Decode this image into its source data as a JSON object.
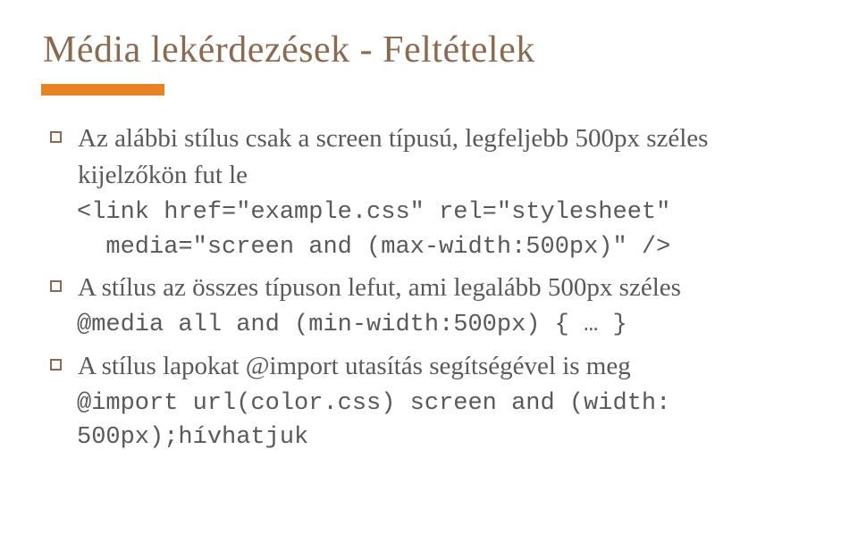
{
  "title": "Média lekérdezések - Feltételek",
  "items": [
    {
      "text": "Az alábbi stílus csak a screen típusú, legfeljebb 500px széles kijelzőkön fut le",
      "code": "<link href=\"example.css\" rel=\"stylesheet\"\n  media=\"screen and (max-width:500px)\" />"
    },
    {
      "text": "A stílus az összes típuson lefut, ami legalább 500px széles",
      "code": "@media all and (min-width:500px) { … }"
    },
    {
      "text": "A stílus lapokat @import utasítás segítségével is meg",
      "code": "@import url(color.css) screen and (width:\n500px);hívhatjuk"
    }
  ]
}
